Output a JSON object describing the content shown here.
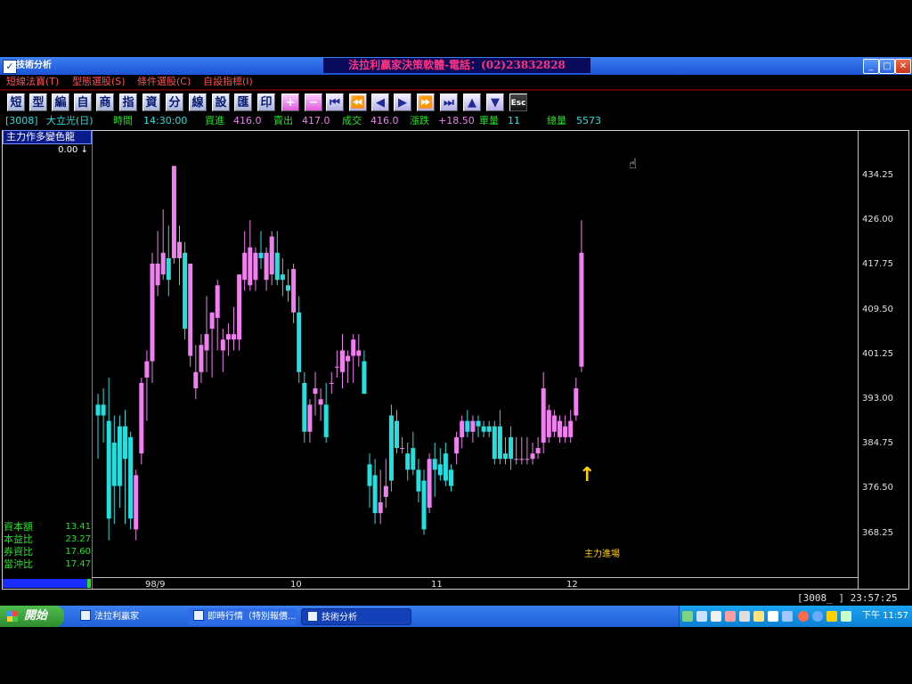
{
  "window": {
    "title": "技術分析",
    "banner": "法拉利贏家決策軟體-電話：(02)23832828",
    "minimize_label": "_",
    "maximize_label": "□",
    "close_label": "✕"
  },
  "menu": [
    "短線法寶(T)",
    "型態選股(S)",
    "條件選股(C)",
    "自設指標(I)"
  ],
  "toolbar": [
    {
      "label": "短",
      "icon": "short-icon"
    },
    {
      "label": "型",
      "icon": "pattern-icon"
    },
    {
      "label": "編",
      "icon": "edit-icon"
    },
    {
      "label": "自",
      "icon": "custom-icon"
    },
    {
      "label": "商",
      "icon": "product-icon"
    },
    {
      "label": "指",
      "icon": "indicator-icon"
    },
    {
      "label": "資",
      "icon": "data-icon"
    },
    {
      "label": "分",
      "icon": "analysis-icon"
    },
    {
      "label": "線",
      "icon": "line-icon"
    },
    {
      "label": "設",
      "icon": "settings-icon"
    },
    {
      "label": "匯",
      "icon": "export-icon"
    },
    {
      "label": "印",
      "icon": "print-icon"
    },
    {
      "label": "+",
      "icon": "zoom-in-icon"
    },
    {
      "label": "−",
      "icon": "zoom-out-icon"
    },
    {
      "label": "⏮",
      "icon": "first-icon"
    },
    {
      "label": "⏪",
      "icon": "rewind-icon"
    },
    {
      "label": "◀",
      "icon": "prev-icon"
    },
    {
      "label": "▶",
      "icon": "next-icon"
    },
    {
      "label": "⏩",
      "icon": "fast-forward-icon"
    },
    {
      "label": "⏭",
      "icon": "last-icon"
    },
    {
      "label": "▲",
      "icon": "up-icon"
    },
    {
      "label": "▼",
      "icon": "down-icon"
    },
    {
      "label": "Esc",
      "icon": "esc-icon"
    }
  ],
  "status": {
    "code": "[3008]",
    "name": "大立光(日)",
    "time_label": "時間",
    "time": "14:30:00",
    "bid_label": "買進",
    "bid": "416.0",
    "ask_label": "賣出",
    "ask": "417.0",
    "trade_label": "成交",
    "trade": "416.0",
    "change_label": "漲跌",
    "change": "+18.50",
    "vol_label": "單量",
    "vol": "11",
    "total_label": "總量",
    "total": "5573"
  },
  "indicator": {
    "name": "主力作多變色龍",
    "value": "0.00"
  },
  "stats": [
    {
      "label": "資本額",
      "value": "13.41"
    },
    {
      "label": "本益比",
      "value": "23.27"
    },
    {
      "label": "券資比",
      "value": "17.60"
    },
    {
      "label": "當沖比",
      "value": "17.47"
    }
  ],
  "annotation": "主力進場",
  "bottom_code": "[3008_  ]  23:57:25",
  "taskbar": {
    "start": "開始",
    "tasks": [
      "法拉利贏家",
      "即時行情（特別報價...",
      "技術分析"
    ],
    "clock": "下午 11:57"
  },
  "colors": {
    "up": "#f07ff0",
    "down": "#22e0e0",
    "axis_text": "#e0e0e0",
    "banner_text": "#ff3380",
    "accent_yellow": "#ffd200"
  },
  "chart_data": {
    "type": "candlestick",
    "y_ticks": [
      "434.25",
      "426.00",
      "417.75",
      "409.50",
      "401.25",
      "393.00",
      "384.75",
      "376.50",
      "368.25"
    ],
    "ylim": [
      363.5,
      441.5
    ],
    "x_labels": [
      {
        "index": 9,
        "label": "98/9"
      },
      {
        "index": 30,
        "label": "10"
      },
      {
        "index": 51,
        "label": "11"
      },
      {
        "index": 72,
        "label": "12"
      }
    ],
    "candles": [
      {
        "o": 392.0,
        "h": 394.0,
        "l": 382.0,
        "c": 390.0
      },
      {
        "o": 392.0,
        "h": 395.0,
        "l": 385.0,
        "c": 390.0
      },
      {
        "o": 389.0,
        "h": 397.0,
        "l": 367.0,
        "c": 371.0
      },
      {
        "o": 385.0,
        "h": 390.0,
        "l": 370.0,
        "c": 377.0
      },
      {
        "o": 388.0,
        "h": 390.0,
        "l": 373.0,
        "c": 377.0
      },
      {
        "o": 388.0,
        "h": 391.0,
        "l": 370.0,
        "c": 382.0
      },
      {
        "o": 386.0,
        "h": 387.0,
        "l": 369.0,
        "c": 371.0
      },
      {
        "o": 369.0,
        "h": 380.0,
        "l": 367.0,
        "c": 379.0
      },
      {
        "o": 383.0,
        "h": 397.0,
        "l": 381.0,
        "c": 396.0
      },
      {
        "o": 397.0,
        "h": 402.0,
        "l": 389.0,
        "c": 400.0
      },
      {
        "o": 400.0,
        "h": 420.0,
        "l": 396.0,
        "c": 418.0
      },
      {
        "o": 414.0,
        "h": 424.0,
        "l": 412.0,
        "c": 418.0
      },
      {
        "o": 416.0,
        "h": 428.0,
        "l": 415.0,
        "c": 420.0
      },
      {
        "o": 419.0,
        "h": 425.0,
        "l": 412.0,
        "c": 415.0
      },
      {
        "o": 419.0,
        "h": 436.0,
        "l": 418.0,
        "c": 436.0
      },
      {
        "o": 419.0,
        "h": 425.0,
        "l": 414.0,
        "c": 422.0
      },
      {
        "o": 420.0,
        "h": 422.0,
        "l": 404.0,
        "c": 406.0
      },
      {
        "o": 401.0,
        "h": 418.0,
        "l": 399.0,
        "c": 418.0
      },
      {
        "o": 395.0,
        "h": 403.0,
        "l": 393.0,
        "c": 398.0
      },
      {
        "o": 398.0,
        "h": 405.0,
        "l": 396.0,
        "c": 403.0
      },
      {
        "o": 402.0,
        "h": 412.0,
        "l": 398.0,
        "c": 405.0
      },
      {
        "o": 406.0,
        "h": 409.0,
        "l": 397.0,
        "c": 409.0
      },
      {
        "o": 408.0,
        "h": 415.0,
        "l": 402.0,
        "c": 414.0
      },
      {
        "o": 402.0,
        "h": 406.0,
        "l": 398.0,
        "c": 404.0
      },
      {
        "o": 404.0,
        "h": 407.0,
        "l": 401.0,
        "c": 405.0
      },
      {
        "o": 404.0,
        "h": 410.0,
        "l": 402.0,
        "c": 405.0
      },
      {
        "o": 404.0,
        "h": 416.0,
        "l": 402.0,
        "c": 416.0
      },
      {
        "o": 415.0,
        "h": 424.0,
        "l": 413.0,
        "c": 420.0
      },
      {
        "o": 414.0,
        "h": 426.0,
        "l": 413.0,
        "c": 421.0
      },
      {
        "o": 415.0,
        "h": 421.0,
        "l": 413.0,
        "c": 420.0
      },
      {
        "o": 420.0,
        "h": 424.0,
        "l": 417.0,
        "c": 419.0
      },
      {
        "o": 415.0,
        "h": 421.0,
        "l": 413.0,
        "c": 420.0
      },
      {
        "o": 416.0,
        "h": 424.0,
        "l": 414.0,
        "c": 423.0
      },
      {
        "o": 420.0,
        "h": 424.0,
        "l": 414.0,
        "c": 415.0
      },
      {
        "o": 416.0,
        "h": 419.0,
        "l": 412.0,
        "c": 415.0
      },
      {
        "o": 414.0,
        "h": 417.0,
        "l": 411.0,
        "c": 413.0
      },
      {
        "o": 409.0,
        "h": 418.0,
        "l": 407.0,
        "c": 417.0
      },
      {
        "o": 409.0,
        "h": 412.0,
        "l": 396.0,
        "c": 398.0
      },
      {
        "o": 396.0,
        "h": 398.0,
        "l": 385.0,
        "c": 387.0
      },
      {
        "o": 387.0,
        "h": 393.0,
        "l": 385.0,
        "c": 392.0
      },
      {
        "o": 394.0,
        "h": 398.0,
        "l": 390.0,
        "c": 395.0
      },
      {
        "o": 392.0,
        "h": 395.0,
        "l": 389.0,
        "c": 393.0
      },
      {
        "o": 392.0,
        "h": 396.0,
        "l": 385.0,
        "c": 386.0
      },
      {
        "o": 396.0,
        "h": 398.0,
        "l": 394.0,
        "c": 396.0
      },
      {
        "o": 399.0,
        "h": 402.0,
        "l": 397.0,
        "c": 399.0
      },
      {
        "o": 398.0,
        "h": 405.0,
        "l": 395.0,
        "c": 402.0
      },
      {
        "o": 400.0,
        "h": 402.0,
        "l": 396.0,
        "c": 401.0
      },
      {
        "o": 401.0,
        "h": 405.0,
        "l": 396.0,
        "c": 404.0
      },
      {
        "o": 401.0,
        "h": 405.0,
        "l": 399.0,
        "c": 402.0
      },
      {
        "o": 400.0,
        "h": 402.0,
        "l": 394.0,
        "c": 394.0
      },
      {
        "o": 381.0,
        "h": 383.0,
        "l": 373.0,
        "c": 377.0
      },
      {
        "o": 379.0,
        "h": 382.0,
        "l": 370.0,
        "c": 372.0
      },
      {
        "o": 372.0,
        "h": 380.0,
        "l": 370.0,
        "c": 374.0
      },
      {
        "o": 375.0,
        "h": 382.0,
        "l": 373.0,
        "c": 377.0
      },
      {
        "o": 390.0,
        "h": 392.0,
        "l": 376.0,
        "c": 378.0
      },
      {
        "o": 389.0,
        "h": 391.0,
        "l": 383.0,
        "c": 384.0
      },
      {
        "o": 384.0,
        "h": 386.0,
        "l": 383.0,
        "c": 384.0
      },
      {
        "o": 383.0,
        "h": 385.0,
        "l": 378.0,
        "c": 380.0
      },
      {
        "o": 384.0,
        "h": 387.0,
        "l": 379.0,
        "c": 380.0
      },
      {
        "o": 380.0,
        "h": 382.0,
        "l": 374.0,
        "c": 376.0
      },
      {
        "o": 378.0,
        "h": 380.0,
        "l": 368.0,
        "c": 369.0
      },
      {
        "o": 373.0,
        "h": 383.0,
        "l": 372.0,
        "c": 382.0
      },
      {
        "o": 382.0,
        "h": 385.0,
        "l": 375.0,
        "c": 380.0
      },
      {
        "o": 381.0,
        "h": 384.0,
        "l": 378.0,
        "c": 379.0
      },
      {
        "o": 383.0,
        "h": 385.0,
        "l": 377.0,
        "c": 378.0
      },
      {
        "o": 380.0,
        "h": 381.0,
        "l": 376.0,
        "c": 377.0
      },
      {
        "o": 383.0,
        "h": 387.0,
        "l": 381.0,
        "c": 386.0
      },
      {
        "o": 386.0,
        "h": 390.0,
        "l": 384.0,
        "c": 389.0
      },
      {
        "o": 389.0,
        "h": 391.0,
        "l": 386.0,
        "c": 387.0
      },
      {
        "o": 387.0,
        "h": 390.0,
        "l": 385.0,
        "c": 389.0
      },
      {
        "o": 389.0,
        "h": 390.0,
        "l": 386.0,
        "c": 388.0
      },
      {
        "o": 388.0,
        "h": 389.0,
        "l": 386.0,
        "c": 387.0
      },
      {
        "o": 388.0,
        "h": 389.0,
        "l": 386.0,
        "c": 387.0
      },
      {
        "o": 388.0,
        "h": 389.0,
        "l": 381.0,
        "c": 382.0
      },
      {
        "o": 388.0,
        "h": 391.0,
        "l": 381.0,
        "c": 382.0
      },
      {
        "o": 383.0,
        "h": 386.0,
        "l": 381.0,
        "c": 382.0
      },
      {
        "o": 386.0,
        "h": 388.0,
        "l": 380.0,
        "c": 382.0
      },
      {
        "o": 382.0,
        "h": 386.0,
        "l": 381.0,
        "c": 382.0
      },
      {
        "o": 382.0,
        "h": 386.0,
        "l": 381.0,
        "c": 382.0
      },
      {
        "o": 382.0,
        "h": 386.0,
        "l": 381.0,
        "c": 382.0
      },
      {
        "o": 382.0,
        "h": 385.0,
        "l": 381.0,
        "c": 383.0
      },
      {
        "o": 383.0,
        "h": 386.0,
        "l": 382.0,
        "c": 384.0
      },
      {
        "o": 385.0,
        "h": 398.0,
        "l": 383.0,
        "c": 395.0
      },
      {
        "o": 386.0,
        "h": 392.0,
        "l": 385.0,
        "c": 391.0
      },
      {
        "o": 387.0,
        "h": 391.0,
        "l": 386.0,
        "c": 390.0
      },
      {
        "o": 386.0,
        "h": 390.0,
        "l": 385.0,
        "c": 389.0
      },
      {
        "o": 386.0,
        "h": 390.0,
        "l": 385.0,
        "c": 388.0
      },
      {
        "o": 386.0,
        "h": 391.0,
        "l": 385.0,
        "c": 389.0
      },
      {
        "o": 390.0,
        "h": 397.0,
        "l": 389.0,
        "c": 395.0
      },
      {
        "o": 399.0,
        "h": 426.0,
        "l": 398.0,
        "c": 420.0
      }
    ]
  }
}
